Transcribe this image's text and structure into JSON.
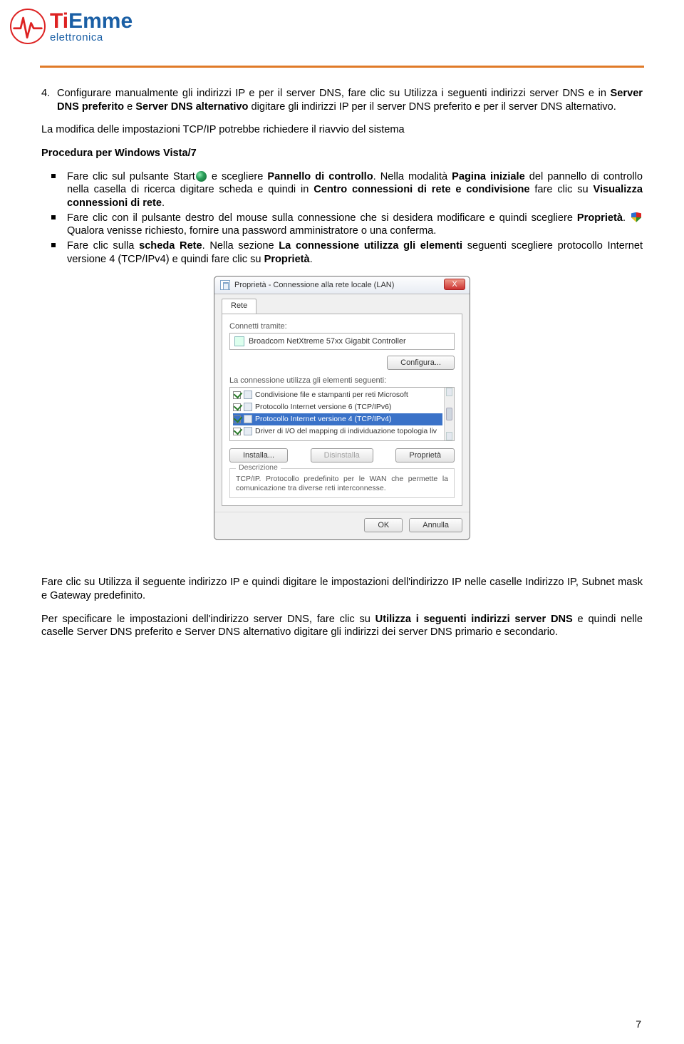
{
  "logo": {
    "brand_ti": "Ti",
    "brand_emme": "Emme",
    "sub": "elettronica"
  },
  "ol4": {
    "num": "4.",
    "text_a": "Configurare manualmente gli indirizzi IP e per il server DNS, fare clic su Utilizza i seguenti indirizzi server DNS e in ",
    "b1": "Server DNS preferito",
    "mid1": " e ",
    "b2": "Server DNS alternativo",
    "text_b": " digitare gli indirizzi IP per il server DNS preferito e per il server DNS alternativo."
  },
  "p_mod": "La modifica delle impostazioni TCP/IP potrebbe richiedere il riavvio del sistema",
  "p_proc": "Procedura per Windows Vista/7",
  "li1": {
    "a": "Fare clic sul pulsante Start",
    "b": " e scegliere ",
    "bold1": "Pannello di controllo",
    "c": ". Nella modalità ",
    "bold2": "Pagina iniziale",
    "d": " del pannello di controllo nella casella di ricerca digitare scheda e quindi in ",
    "bold3": "Centro connessioni di rete e condivisione",
    "e": " fare clic su ",
    "bold4": "Visualizza connessioni di rete",
    "f": "."
  },
  "li2": {
    "a": "Fare clic con il pulsante destro del mouse sulla connessione che si desidera modificare e quindi scegliere ",
    "bold1": "Proprietà",
    "b": ". ",
    "c": " Qualora venisse richiesto, fornire una password amministratore o una conferma."
  },
  "li3": {
    "a": "Fare clic sulla ",
    "bold1": "scheda Rete",
    "b": ". Nella sezione ",
    "bold2": "La connessione utilizza gli elementi",
    "c": " seguenti scegliere protocollo Internet versione 4 (TCP/IPv4) e quindi fare clic su ",
    "bold3": "Proprietà",
    "d": "."
  },
  "dlg": {
    "title": "Proprietà - Connessione alla rete locale (LAN)",
    "tab": "Rete",
    "connect_via": "Connetti tramite:",
    "adapter": "Broadcom NetXtreme 57xx Gigabit Controller",
    "configure": "Configura...",
    "uses": "La connessione utilizza gli elementi seguenti:",
    "rows": [
      "Condivisione file e stampanti per reti Microsoft",
      "Protocollo Internet versione 6 (TCP/IPv6)",
      "Protocollo Internet versione 4 (TCP/IPv4)",
      "Driver di I/O del mapping di individuazione topologia liv"
    ],
    "install": "Installa...",
    "uninstall": "Disinstalla",
    "props": "Proprietà",
    "desc_h": "Descrizione",
    "desc": "TCP/IP. Protocollo predefinito per le WAN che permette la comunicazione tra diverse reti interconnesse.",
    "ok": "OK",
    "cancel": "Annulla"
  },
  "p_after1": "Fare clic su Utilizza il seguente indirizzo IP e quindi digitare le impostazioni dell'indirizzo IP nelle caselle Indirizzo IP, Subnet mask e Gateway predefinito.",
  "p_after2_a": "Per specificare le impostazioni dell'indirizzo server DNS, fare clic su ",
  "p_after2_b": "Utilizza i seguenti indirizzi server DNS",
  "p_after2_c": " e quindi nelle caselle Server DNS preferito e Server DNS alternativo digitare gli indirizzi dei server DNS primario e secondario.",
  "page": "7"
}
